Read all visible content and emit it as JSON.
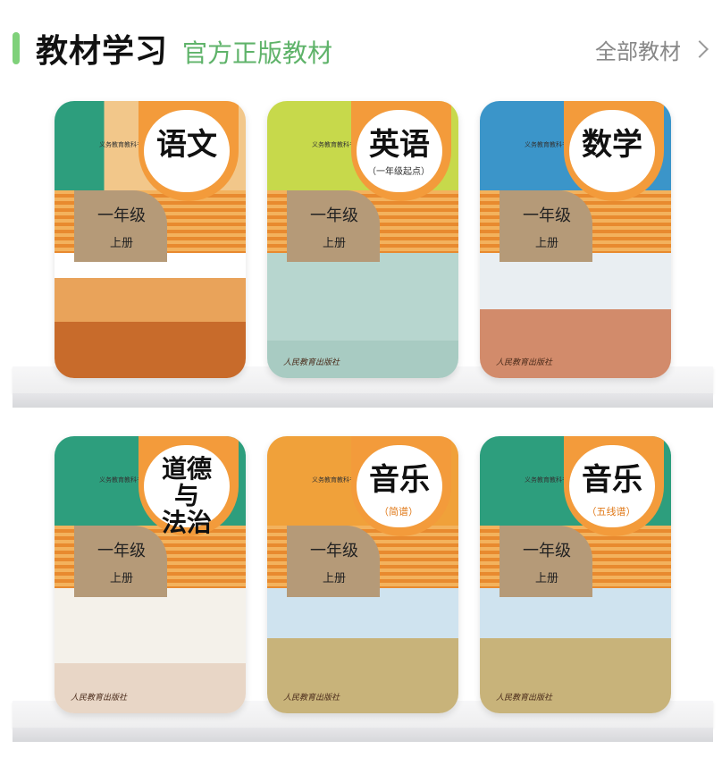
{
  "header": {
    "title": "教材学习",
    "subtitle": "官方正版教材",
    "all_label": "全部教材"
  },
  "books": [
    {
      "subject": "语文",
      "series": "义务教育教科书",
      "grade": "一年级",
      "term": "上册",
      "edition": "",
      "publisher": ""
    },
    {
      "subject": "英语",
      "series": "义务教育教科书",
      "grade": "一年级",
      "term": "上册",
      "edition": "（一年级起点）",
      "publisher": "人民教育出版社"
    },
    {
      "subject": "数学",
      "series": "义务教育教科书",
      "grade": "一年级",
      "term": "上册",
      "edition": "",
      "publisher": "人民教育出版社"
    },
    {
      "subject": "道德\n与\n法治",
      "series": "义务教育教科书",
      "grade": "一年级",
      "term": "上册",
      "edition": "",
      "publisher": "人民教育出版社"
    },
    {
      "subject": "音乐",
      "series": "义务教育教科书",
      "grade": "一年级",
      "term": "上册",
      "edition": "（简谱）",
      "publisher": "人民教育出版社"
    },
    {
      "subject": "音乐",
      "series": "义务教育教科书",
      "grade": "一年级",
      "term": "上册",
      "edition": "（五线谱）",
      "publisher": "人民教育出版社"
    }
  ],
  "colors": {
    "accent": "#7fd17a",
    "subtitle": "#5fb36a",
    "badge": "#f39b3b"
  }
}
